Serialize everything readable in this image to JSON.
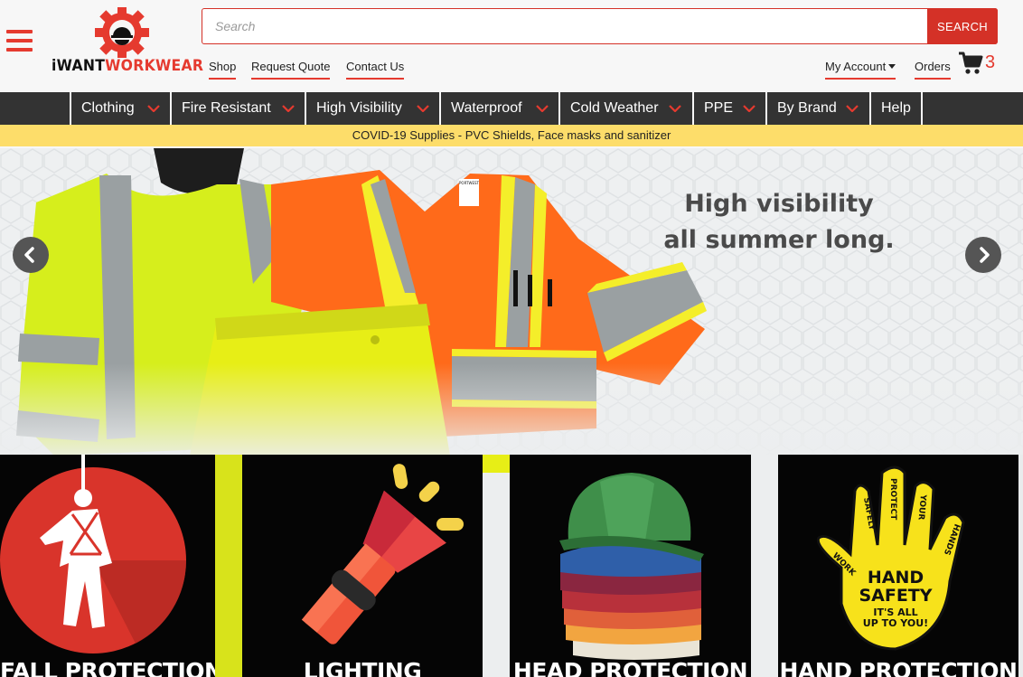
{
  "header": {
    "logo": {
      "text_part1": "iWANT",
      "text_part2": "WORKWEAR"
    },
    "search": {
      "placeholder": "Search",
      "button_label": "SEARCH"
    },
    "links": {
      "shop": "Shop",
      "request_quote": "Request Quote",
      "contact_us": "Contact Us",
      "my_account": "My Account",
      "orders": "Orders"
    },
    "cart_count": "3"
  },
  "nav": {
    "items": [
      {
        "label": "Clothing",
        "has_dropdown": true
      },
      {
        "label": "Fire Resistant",
        "has_dropdown": true
      },
      {
        "label": "High Visibility",
        "has_dropdown": true
      },
      {
        "label": "Waterproof",
        "has_dropdown": true
      },
      {
        "label": "Cold Weather",
        "has_dropdown": true
      },
      {
        "label": "PPE",
        "has_dropdown": true
      },
      {
        "label": "By Brand",
        "has_dropdown": true
      },
      {
        "label": "Help",
        "has_dropdown": false
      }
    ]
  },
  "announcement": "COVID-19 Supplies - PVC Shields, Face masks and sanitizer",
  "hero": {
    "title_line1": "High visibility",
    "title_line2": "all summer long.",
    "prev_icon": "chevron-left-icon",
    "next_icon": "chevron-right-icon",
    "vest_label": "PORTWEST"
  },
  "categories": [
    {
      "label": "FALL PROTECTION",
      "icon": "harness-person-icon"
    },
    {
      "label": "LIGHTING",
      "icon": "flashlight-icon"
    },
    {
      "label": "HEAD PROTECTION",
      "icon": "hard-hat-stack-icon"
    },
    {
      "label": "HAND PROTECTION",
      "icon": "hand-safety-icon",
      "artwork_text": {
        "headline_1": "HAND",
        "headline_2": "SAFETY",
        "sub_1": "IT'S ALL",
        "sub_2": "UP TO YOU!",
        "finger_words": [
          "WORK",
          "SAFELY",
          "PROTECT",
          "YOUR",
          "HANDS"
        ]
      }
    }
  ],
  "colors": {
    "accent": "#e53a2f",
    "nav_bg": "#333333",
    "banner_bg": "#fddd6a",
    "hero_text": "#4a4a4a",
    "hivis_yellow": "#d9f01b",
    "hivis_orange": "#ff6a1a"
  }
}
